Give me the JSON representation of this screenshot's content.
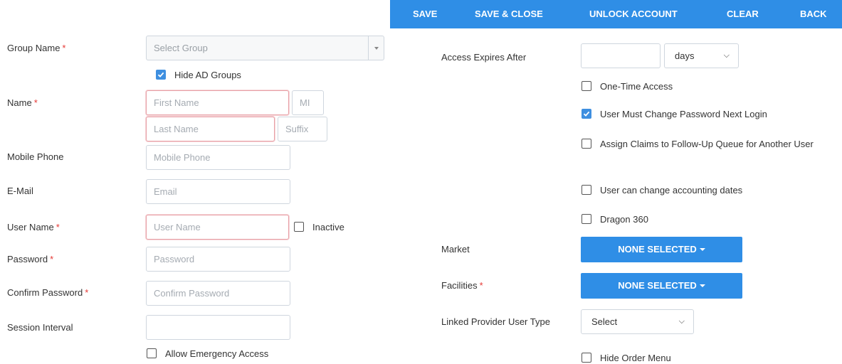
{
  "toolbar": {
    "save": "SAVE",
    "save_close": "SAVE & CLOSE",
    "unlock": "UNLOCK ACCOUNT",
    "clear": "CLEAR",
    "back": "BACK"
  },
  "left": {
    "group_name_label": "Group Name",
    "group_select_placeholder": "Select Group",
    "hide_ad_groups_label": "Hide AD Groups",
    "hide_ad_groups_checked": true,
    "name_label": "Name",
    "first_name_placeholder": "First Name",
    "mi_placeholder": "MI",
    "last_name_placeholder": "Last Name",
    "suffix_placeholder": "Suffix",
    "mobile_label": "Mobile Phone",
    "mobile_placeholder": "Mobile Phone",
    "email_label": "E-Mail",
    "email_placeholder": "Email",
    "username_label": "User Name",
    "username_placeholder": "User Name",
    "inactive_label": "Inactive",
    "password_label": "Password",
    "password_placeholder": "Password",
    "confirm_label": "Confirm Password",
    "confirm_placeholder": "Confirm Password",
    "session_label": "Session Interval",
    "session_value": "",
    "emergency_label": "Allow Emergency Access",
    "required_mark": "*"
  },
  "right": {
    "access_expires_label": "Access Expires After",
    "access_expires_value": "",
    "days_option": "days",
    "one_time_label": "One-Time Access",
    "must_change_label": "User Must Change Password Next Login",
    "must_change_checked": true,
    "assign_claims_label": "Assign Claims to Follow-Up Queue for Another User",
    "accounting_label": "User can change accounting dates",
    "dragon_label": "Dragon 360",
    "market_label": "Market",
    "market_value": "NONE SELECTED",
    "facilities_label": "Facilities",
    "facilities_value": "NONE SELECTED",
    "linked_label": "Linked Provider User Type",
    "linked_value": "Select",
    "hide_order_label": "Hide Order Menu"
  },
  "colors": {
    "primary": "#2f8ee6",
    "required": "#e53935",
    "invalid_border": "#e8a0a6",
    "checkbox_checked": "#3e8fe0"
  }
}
